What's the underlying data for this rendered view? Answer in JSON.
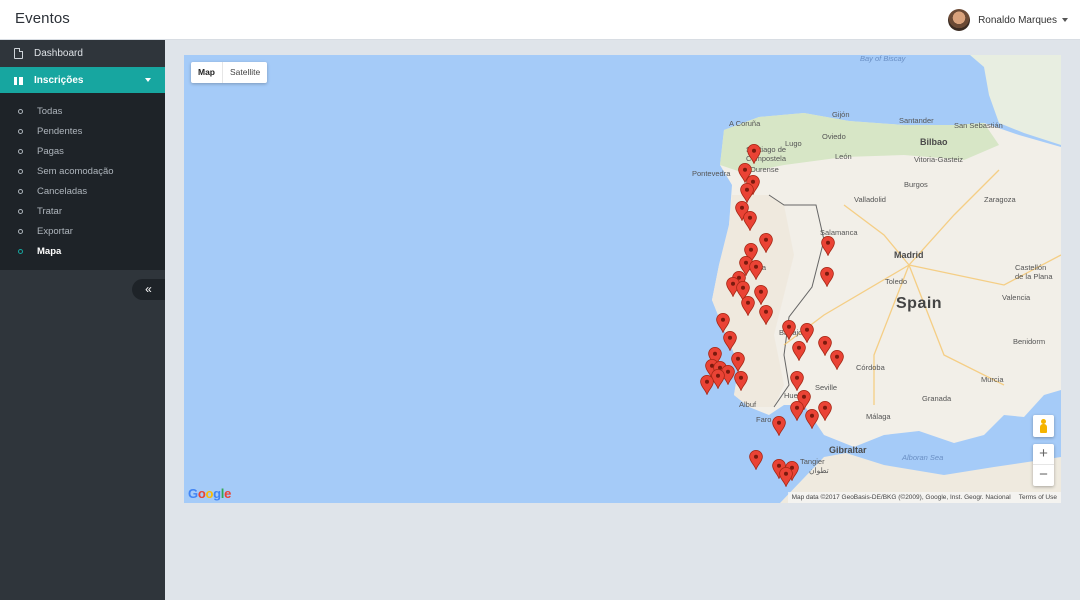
{
  "app": {
    "title": "Eventos"
  },
  "user": {
    "name": "Ronaldo Marques"
  },
  "sidebar": {
    "dashboard_label": "Dashboard",
    "section_label": "Inscrições",
    "items": [
      {
        "label": "Todas"
      },
      {
        "label": "Pendentes"
      },
      {
        "label": "Pagas"
      },
      {
        "label": "Sem acomodação"
      },
      {
        "label": "Canceladas"
      },
      {
        "label": "Tratar"
      },
      {
        "label": "Exportar"
      },
      {
        "label": "Mapa"
      }
    ],
    "active_item": "Mapa",
    "collapse_glyph": "«"
  },
  "map": {
    "type_options": [
      "Map",
      "Satellite"
    ],
    "selected_type": "Map",
    "labels": {
      "spain": "Spain",
      "madrid": "Madrid",
      "gibraltar": "Gibraltar",
      "bay_of_biscay": "Bay of Biscay",
      "alboran_sea": "Alboran Sea",
      "coruna": "A Coruña",
      "gijon": "Gijón",
      "oviedo": "Oviedo",
      "santander": "Santander",
      "bilbao": "Bilbao",
      "san_sebastian": "San Sebastián",
      "santiago": "Santiago de Compostela",
      "lugo": "Lugo",
      "leon": "León",
      "vitoria": "Vitoria-Gasteiz",
      "ourense": "Ourense",
      "pontevedra": "Pontevedra",
      "valladolid": "Valladolid",
      "burgos": "Burgos",
      "zaragoza": "Zaragoza",
      "salamanca": "Salamanca",
      "coimbra": "mbra",
      "toledo": "Toledo",
      "castellon": "Castellón de la Plana",
      "valencia": "Valencia",
      "badajoz": "Badajoz",
      "benidorm": "Benidorm",
      "cordoba": "Córdoba",
      "murcia": "Murcia",
      "sevilla": "Seville",
      "huelva": "Huelva",
      "granada": "Granada",
      "malaga": "Málaga",
      "albufeira": "Albuf",
      "faro": "Faro",
      "tangier": "Tangier",
      "tetouan": "تطوان"
    },
    "zoom_in": "+",
    "zoom_out": "−",
    "logo": "Google",
    "attribution": "Map data ©2017 GeoBasis-DE/BKG (©2009), Google, Inst. Geogr. Nacional",
    "terms": "Terms of Use",
    "marker_color": "#ea4335",
    "markers": [
      {
        "lon": -8.43,
        "lat": 42.1
      },
      {
        "lon": -8.62,
        "lat": 41.8
      },
      {
        "lon": -8.45,
        "lat": 41.62
      },
      {
        "lon": -8.58,
        "lat": 41.48
      },
      {
        "lon": -8.67,
        "lat": 41.2
      },
      {
        "lon": -8.52,
        "lat": 41.05
      },
      {
        "lon": -8.2,
        "lat": 40.7
      },
      {
        "lon": -6.98,
        "lat": 40.66
      },
      {
        "lon": -8.5,
        "lat": 40.55
      },
      {
        "lon": -8.6,
        "lat": 40.35
      },
      {
        "lon": -8.4,
        "lat": 40.28
      },
      {
        "lon": -7.0,
        "lat": 40.18
      },
      {
        "lon": -8.73,
        "lat": 40.12
      },
      {
        "lon": -8.85,
        "lat": 40.02
      },
      {
        "lon": -8.65,
        "lat": 39.95
      },
      {
        "lon": -8.3,
        "lat": 39.9
      },
      {
        "lon": -8.55,
        "lat": 39.72
      },
      {
        "lon": -8.2,
        "lat": 39.58
      },
      {
        "lon": -9.05,
        "lat": 39.45
      },
      {
        "lon": -7.75,
        "lat": 39.35
      },
      {
        "lon": -7.4,
        "lat": 39.3
      },
      {
        "lon": -8.9,
        "lat": 39.18
      },
      {
        "lon": -7.05,
        "lat": 39.1
      },
      {
        "lon": -7.55,
        "lat": 39.02
      },
      {
        "lon": -9.2,
        "lat": 38.92
      },
      {
        "lon": -8.75,
        "lat": 38.85
      },
      {
        "lon": -6.8,
        "lat": 38.88
      },
      {
        "lon": -9.25,
        "lat": 38.74
      },
      {
        "lon": -9.1,
        "lat": 38.7
      },
      {
        "lon": -8.95,
        "lat": 38.65
      },
      {
        "lon": -9.15,
        "lat": 38.58
      },
      {
        "lon": -8.7,
        "lat": 38.55
      },
      {
        "lon": -7.6,
        "lat": 38.55
      },
      {
        "lon": -9.35,
        "lat": 38.48
      },
      {
        "lon": -7.45,
        "lat": 38.25
      },
      {
        "lon": -7.6,
        "lat": 38.08
      },
      {
        "lon": -7.05,
        "lat": 38.08
      },
      {
        "lon": -7.3,
        "lat": 37.95
      },
      {
        "lon": -7.95,
        "lat": 37.85
      },
      {
        "lon": -8.4,
        "lat": 37.32
      },
      {
        "lon": -7.95,
        "lat": 37.18
      },
      {
        "lon": -7.7,
        "lat": 37.15
      },
      {
        "lon": -7.8,
        "lat": 37.05
      }
    ]
  }
}
